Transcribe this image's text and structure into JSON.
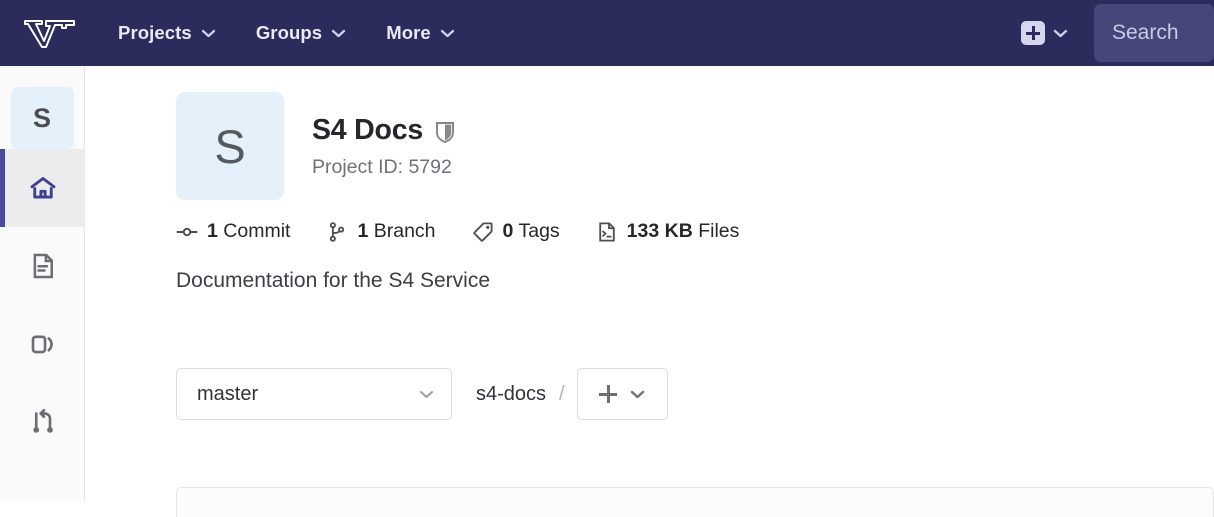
{
  "topnav": {
    "logo_name": "vt-logo",
    "items": [
      {
        "label": "Projects",
        "icon": "chevron-down-icon"
      },
      {
        "label": "Groups",
        "icon": "chevron-down-icon"
      },
      {
        "label": "More",
        "icon": "chevron-down-icon"
      }
    ],
    "create_menu": {
      "icon": "plus-square-icon",
      "chevron": "chevron-down-icon"
    },
    "search": {
      "placeholder": "Search",
      "value": ""
    },
    "background_color": "#2b2b5c",
    "search_background_color": "#46467a"
  },
  "sidebar": {
    "avatar_letter": "S",
    "avatar_background_color": "#e4f1fa",
    "active_indicator_color": "#4a4a9c",
    "items": [
      {
        "name": "project-overview",
        "icon": "home-icon",
        "active": true
      },
      {
        "name": "repository",
        "icon": "file-document-icon",
        "active": false
      },
      {
        "name": "issues",
        "icon": "issues-icon",
        "active": false
      },
      {
        "name": "merge-requests",
        "icon": "merge-request-icon",
        "active": false
      }
    ]
  },
  "project": {
    "avatar_letter": "S",
    "title": "S4 Docs",
    "visibility_icon": "shield-icon",
    "project_id_label": "Project ID: 5792",
    "description": "Documentation for the S4 Service",
    "stats": [
      {
        "icon": "commit-icon",
        "value": "1",
        "label": "Commit"
      },
      {
        "icon": "branch-icon",
        "value": "1",
        "label": "Branch"
      },
      {
        "icon": "tag-icon",
        "value": "0",
        "label": "Tags"
      },
      {
        "icon": "file-size-icon",
        "value": "133 KB",
        "label": "Files"
      }
    ]
  },
  "repo_nav": {
    "branch_selected": "master",
    "branch_chevron": "chevron-down-icon",
    "breadcrumb_root": "s4-docs",
    "breadcrumb_separator": "/",
    "add_button": {
      "icon": "plus-icon",
      "chevron": "chevron-down-icon"
    }
  }
}
